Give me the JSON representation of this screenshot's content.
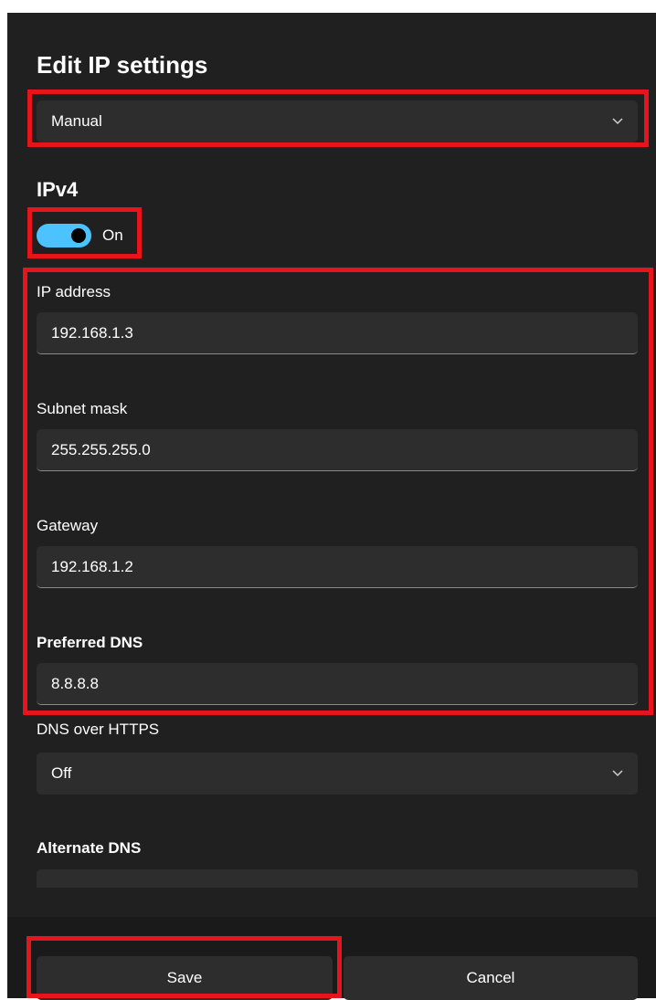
{
  "dialog": {
    "title": "Edit IP settings",
    "mode_select": {
      "value": "Manual",
      "chevron_icon": "chevron-down-icon"
    }
  },
  "ipv4": {
    "title": "IPv4",
    "toggle": {
      "state": "On",
      "on": true,
      "accent_color": "#4cc2ff"
    },
    "fields": [
      {
        "label": "IP address",
        "value": "192.168.1.3"
      },
      {
        "label": "Subnet mask",
        "value": "255.255.255.0"
      },
      {
        "label": "Gateway",
        "value": "192.168.1.2"
      },
      {
        "label": "Preferred DNS",
        "value": "8.8.8.8"
      }
    ],
    "dns_over_https": {
      "label": "DNS over HTTPS",
      "value": "Off",
      "chevron_icon": "chevron-down-icon"
    },
    "alternate_dns": {
      "label": "Alternate DNS",
      "value": ""
    }
  },
  "footer": {
    "save_label": "Save",
    "cancel_label": "Cancel"
  },
  "colors": {
    "background": "#202020",
    "control": "#2d2d2d",
    "highlight": "#e8141c"
  }
}
